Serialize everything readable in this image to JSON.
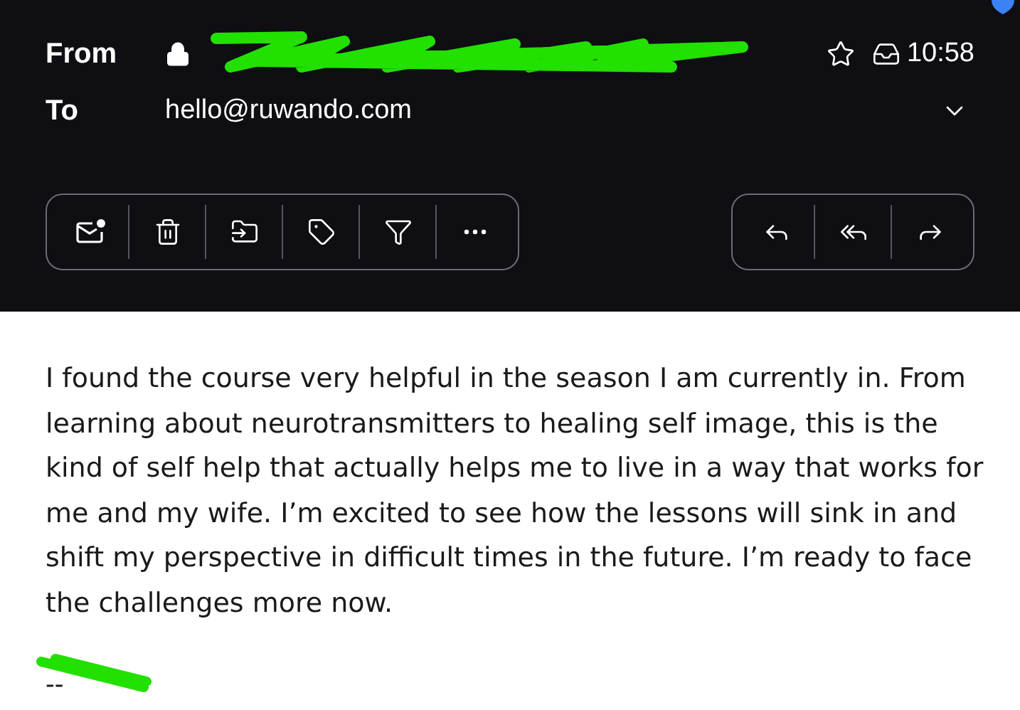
{
  "header": {
    "from_label": "From",
    "to_label": "To",
    "to_address": "hello@ruwando.com",
    "time": "10:58",
    "starred": false
  },
  "toolbar_left": [
    {
      "kind": "unread"
    },
    {
      "kind": "delete"
    },
    {
      "kind": "move"
    },
    {
      "kind": "label"
    },
    {
      "kind": "filter"
    },
    {
      "kind": "more"
    }
  ],
  "toolbar_right": [
    {
      "kind": "reply"
    },
    {
      "kind": "reply_all"
    },
    {
      "kind": "forward"
    }
  ],
  "body": {
    "paragraph": "I found the course very helpful in the season I am currently in. From learning about neurotransmitters to healing self image, this is the kind of self help that actually helps me to live in a way that works for me and my wife. I’m excited to see how the lessons will sink in and shift my perspective in difficult times in the future. I’m ready to face the challenges more now.",
    "signature": "--"
  }
}
